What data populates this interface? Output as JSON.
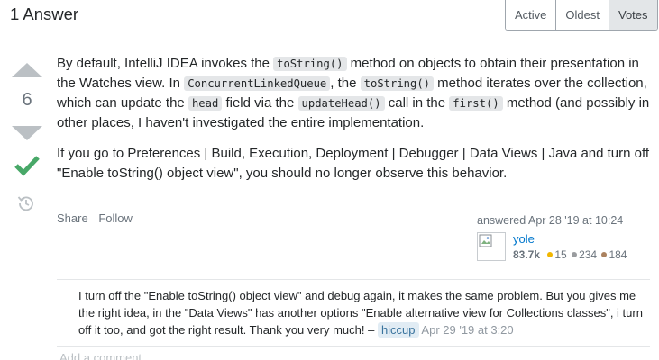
{
  "header": {
    "answers_title": "1 Answer",
    "sort_tabs": [
      "Active",
      "Oldest",
      "Votes"
    ]
  },
  "vote": {
    "count": "6"
  },
  "answer": {
    "p1": {
      "t1": "By default, IntelliJ IDEA invokes the ",
      "c1": "toString()",
      "t2": " method on objects to obtain their presentation in the Watches view. In ",
      "c2": "ConcurrentLinkedQueue",
      "t3": ", the ",
      "c3": "toString()",
      "t4": " method iterates over the collection, which can update the ",
      "c4": "head",
      "t5": " field via the ",
      "c5": "updateHead()",
      "t6": " call in the ",
      "c6": "first()",
      "t7": " method (and possibly in other places, I haven't investigated the entire implementation."
    },
    "p2": "If you go to Preferences | Build, Execution, Deployment | Debugger | Data Views | Java and turn off \"Enable toString() object view\", you should no longer observe this behavior."
  },
  "post_menu": {
    "share": "Share",
    "follow": "Follow"
  },
  "signature": {
    "action": "answered Apr 28 '19 at 10:24",
    "name": "yole",
    "reputation": "83.7k",
    "gold": "15",
    "silver": "234",
    "bronze": "184"
  },
  "comment": {
    "text": "I turn off the \"Enable toString() object view\" and debug again, it makes the same problem. But you gives me the right idea, in the \"Data Views\" has another options \"Enable alternative view for Collections classes\", i turn off it too, and got the right result. Thank you very much! – ",
    "user": "hiccup",
    "date": "Apr 29 '19 at 3:20"
  },
  "add_comment": "Add a comment",
  "colors": {
    "accepted": "#48a868",
    "gold": "#f1b600",
    "silver": "#9a9c9f",
    "bronze": "#ab825f"
  }
}
